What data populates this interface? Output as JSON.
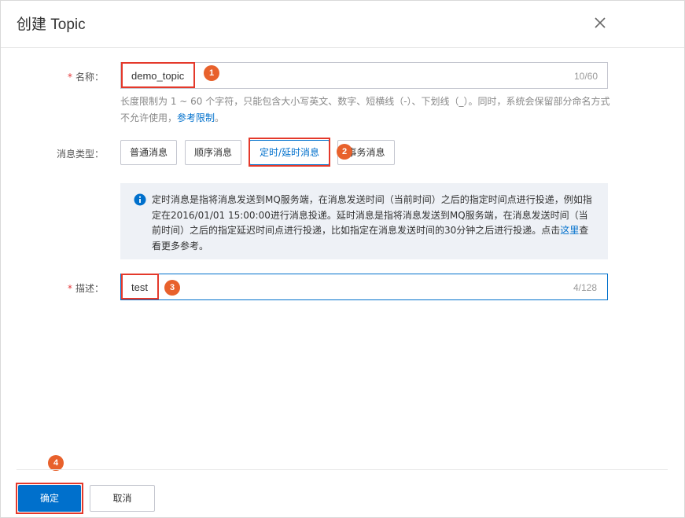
{
  "dialog": {
    "title": "创建 Topic"
  },
  "form": {
    "name": {
      "label": "名称：",
      "required_mark": "*",
      "value": "demo_topic",
      "counter": "10/60",
      "help_text": "长度限制为 1 ~ 60 个字符，只能包含大小写英文、数字、短横线（-）、下划线（_）。同时，系统会保留部分命名方式不允许使用，",
      "help_link": "参考限制",
      "help_end": "。"
    },
    "message_type": {
      "label": "消息类型：",
      "options": [
        "普通消息",
        "顺序消息",
        "定时/延时消息",
        "事务消息"
      ],
      "selected": "定时/延时消息"
    },
    "info": {
      "text": "定时消息是指将消息发送到MQ服务端，在消息发送时间（当前时间）之后的指定时间点进行投递，例如指定在2016/01/01 15:00:00进行消息投递。延时消息是指将消息发送到MQ服务端，在消息发送时间（当前时间）之后的指定延迟时间点进行投递，比如指定在消息发送时间的30分钟之后进行投递。点击",
      "link": "这里",
      "text_end": "查看更多参考。"
    },
    "description": {
      "label": "描述：",
      "required_mark": "*",
      "value": "test",
      "counter": "4/128"
    }
  },
  "footer": {
    "confirm_label": "确定",
    "cancel_label": "取消"
  },
  "annotations": {
    "step1": "1",
    "step2": "2",
    "step3": "3",
    "step4": "4"
  },
  "colors": {
    "primary": "#0070cc",
    "highlight": "#e4392b",
    "step_badge": "#e8612c",
    "info_bg": "#eef1f6"
  }
}
